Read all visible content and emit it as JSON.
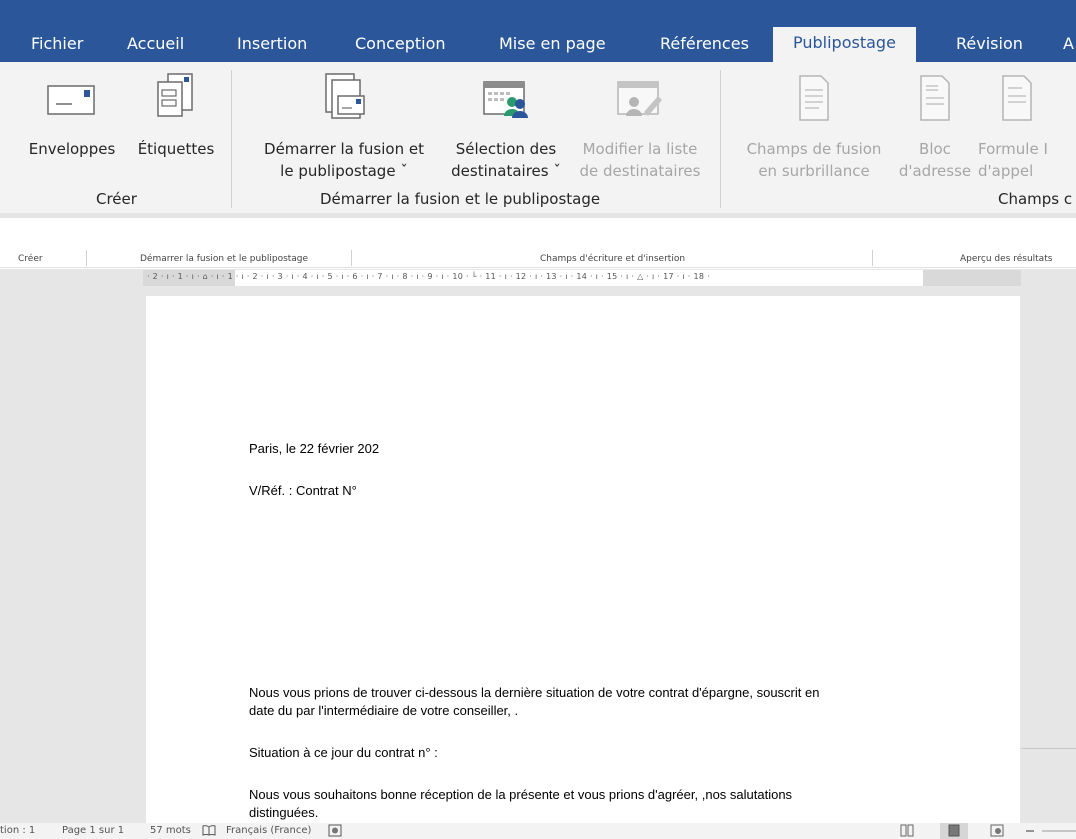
{
  "tabs": [
    {
      "label": "Fichier",
      "active": false
    },
    {
      "label": "Accueil",
      "active": false
    },
    {
      "label": "Insertion",
      "active": false
    },
    {
      "label": "Conception",
      "active": false
    },
    {
      "label": "Mise en page",
      "active": false
    },
    {
      "label": "Références",
      "active": false
    },
    {
      "label": "Publipostage",
      "active": true
    },
    {
      "label": "Révision",
      "active": false
    },
    {
      "label": "A",
      "active": false
    }
  ],
  "ribbon": {
    "groups": {
      "creer": "Créer",
      "demarrer": "Démarrer la fusion et le publipostage",
      "champs": "Champs c"
    },
    "buttons": {
      "enveloppes": "Enveloppes",
      "etiquettes": "Étiquettes",
      "demarrer_l1": "Démarrer la fusion et",
      "demarrer_l2": "le publipostage ˇ",
      "selection_l1": "Sélection des",
      "selection_l2": "destinataires ˇ",
      "modifier_l1": "Modifier la liste",
      "modifier_l2": "de destinataires",
      "champs_l1": "Champs de fusion",
      "champs_l2": "en surbrillance",
      "bloc_l1": "Bloc",
      "bloc_l2": "d'adresse",
      "formule_l1": "Formule I",
      "formule_l2": "d'appel"
    }
  },
  "strip": {
    "creer": "Créer",
    "demarrer": "Démarrer la fusion et le publipostage",
    "champs": "Champs d'écriture et d'insertion",
    "apercu": "Aperçu des résultats"
  },
  "ruler": {
    "ticks": "· 2 · ı · 1 · ı · ⌂ · ı · 1 · ı · 2 · ı · 3 · ı · 4 · ı · 5 · ı · 6 · ı · 7 · ı · 8 · ı · 9 · ı · 10 · └ · 11 · ı · 12 · ı · 13 · ı · 14 · ı · 15 · ı · △ · ı · 17 · ı · 18 ·"
  },
  "document": {
    "date_line": "Paris, le 22 février 202",
    "ref_line": "V/Réf. : Contrat N°",
    "para1_l1": "Nous vous prions de trouver ci-dessous la dernière situation de votre contrat d'épargne, souscrit en",
    "para1_l2": "date du     par l'intermédiaire de votre conseiller,  .",
    "situation": "Situation à ce jour du contrat n°   :",
    "closing_l1": "Nous vous souhaitons bonne réception de la présente et vous prions d'agréer, ,nos salutations",
    "closing_l2": "distinguées."
  },
  "status": {
    "section": "tion : 1",
    "page": "Page 1 sur 1",
    "words": "57 mots",
    "language": "Français (France)"
  },
  "colors": {
    "tabbar": "#2b579a",
    "ribbon_bg": "#f3f3f3",
    "doc_bg": "#e6e6e6"
  }
}
